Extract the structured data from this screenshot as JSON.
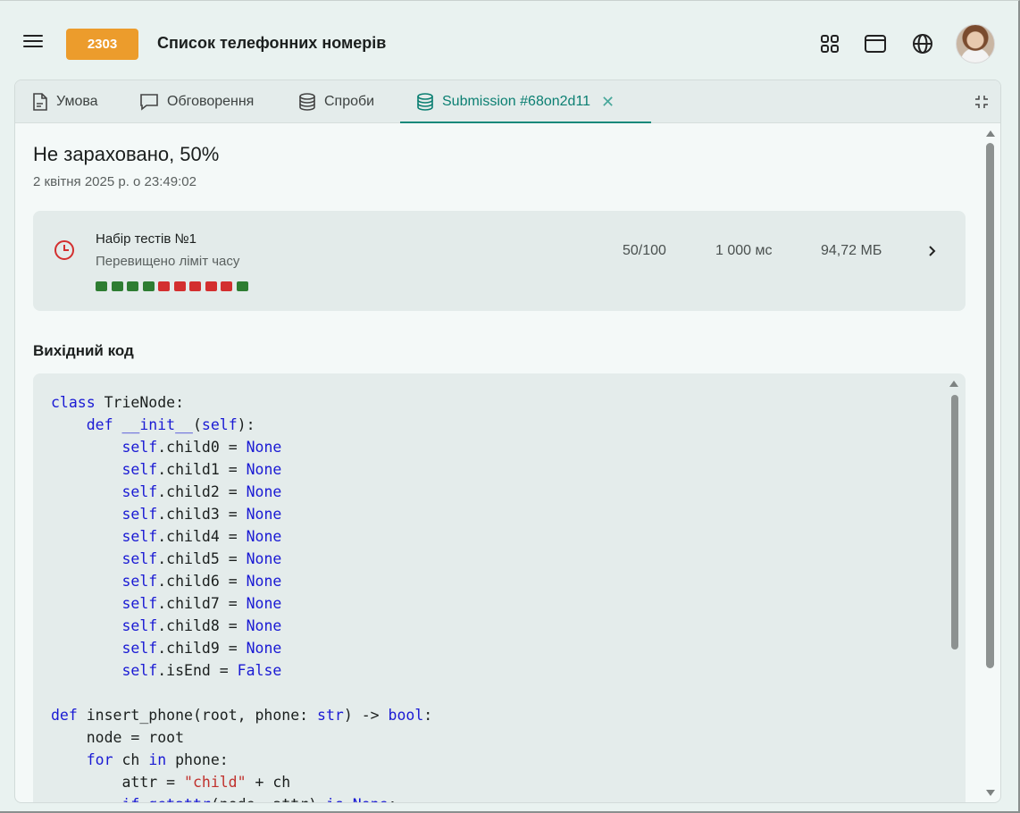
{
  "header": {
    "badge": "2303",
    "title": "Список телефонних номерів",
    "icons": [
      "menu-icon",
      "apps-grid-icon",
      "window-icon",
      "globe-icon"
    ]
  },
  "tabs": [
    {
      "label": "Умова",
      "icon": "document-icon"
    },
    {
      "label": "Обговорення",
      "icon": "chat-icon"
    },
    {
      "label": "Спроби",
      "icon": "database-icon"
    },
    {
      "label": "Submission #68on2d11",
      "icon": "database-icon",
      "active": true
    }
  ],
  "submission": {
    "verdict": "Не зараховано, 50%",
    "date": "2 квітня 2025 р. о 23:49:02"
  },
  "testset": {
    "name": "Набір тестів №1",
    "status": "Перевищено ліміт часу",
    "score": "50/100",
    "time": "1 000 мс",
    "memory": "94,72 МБ",
    "results": [
      "pass",
      "pass",
      "pass",
      "pass",
      "fail",
      "fail",
      "fail",
      "fail",
      "fail",
      "pass"
    ],
    "colors": {
      "pass": "#2e7d32",
      "fail": "#d32f2f"
    }
  },
  "source": {
    "label": "Вихідний код",
    "lines": [
      [
        [
          "kw",
          "class"
        ],
        [
          "t",
          " TrieNode:"
        ]
      ],
      [
        [
          "t",
          "    "
        ],
        [
          "kw",
          "def"
        ],
        [
          "t",
          " "
        ],
        [
          "kw",
          "__init__"
        ],
        [
          "t",
          "("
        ],
        [
          "kw",
          "self"
        ],
        [
          "t",
          "):"
        ]
      ],
      [
        [
          "t",
          "        "
        ],
        [
          "kw",
          "self"
        ],
        [
          "t",
          ".child0 = "
        ],
        [
          "kw",
          "None"
        ]
      ],
      [
        [
          "t",
          "        "
        ],
        [
          "kw",
          "self"
        ],
        [
          "t",
          ".child1 = "
        ],
        [
          "kw",
          "None"
        ]
      ],
      [
        [
          "t",
          "        "
        ],
        [
          "kw",
          "self"
        ],
        [
          "t",
          ".child2 = "
        ],
        [
          "kw",
          "None"
        ]
      ],
      [
        [
          "t",
          "        "
        ],
        [
          "kw",
          "self"
        ],
        [
          "t",
          ".child3 = "
        ],
        [
          "kw",
          "None"
        ]
      ],
      [
        [
          "t",
          "        "
        ],
        [
          "kw",
          "self"
        ],
        [
          "t",
          ".child4 = "
        ],
        [
          "kw",
          "None"
        ]
      ],
      [
        [
          "t",
          "        "
        ],
        [
          "kw",
          "self"
        ],
        [
          "t",
          ".child5 = "
        ],
        [
          "kw",
          "None"
        ]
      ],
      [
        [
          "t",
          "        "
        ],
        [
          "kw",
          "self"
        ],
        [
          "t",
          ".child6 = "
        ],
        [
          "kw",
          "None"
        ]
      ],
      [
        [
          "t",
          "        "
        ],
        [
          "kw",
          "self"
        ],
        [
          "t",
          ".child7 = "
        ],
        [
          "kw",
          "None"
        ]
      ],
      [
        [
          "t",
          "        "
        ],
        [
          "kw",
          "self"
        ],
        [
          "t",
          ".child8 = "
        ],
        [
          "kw",
          "None"
        ]
      ],
      [
        [
          "t",
          "        "
        ],
        [
          "kw",
          "self"
        ],
        [
          "t",
          ".child9 = "
        ],
        [
          "kw",
          "None"
        ]
      ],
      [
        [
          "t",
          "        "
        ],
        [
          "kw",
          "self"
        ],
        [
          "t",
          ".isEnd = "
        ],
        [
          "kw",
          "False"
        ]
      ],
      [
        [
          "t",
          ""
        ]
      ],
      [
        [
          "kw",
          "def"
        ],
        [
          "t",
          " insert_phone(root, phone: "
        ],
        [
          "kw",
          "str"
        ],
        [
          "t",
          ") -> "
        ],
        [
          "kw",
          "bool"
        ],
        [
          "t",
          ":"
        ]
      ],
      [
        [
          "t",
          "    node = root"
        ]
      ],
      [
        [
          "t",
          "    "
        ],
        [
          "kw",
          "for"
        ],
        [
          "t",
          " ch "
        ],
        [
          "kw",
          "in"
        ],
        [
          "t",
          " phone:"
        ]
      ],
      [
        [
          "t",
          "        attr = "
        ],
        [
          "str",
          "\"child\""
        ],
        [
          "t",
          " + ch"
        ]
      ],
      [
        [
          "t",
          "        "
        ],
        [
          "kw",
          "if"
        ],
        [
          "t",
          " "
        ],
        [
          "kw",
          "getattr"
        ],
        [
          "t",
          "(node, attr) "
        ],
        [
          "kw",
          "is"
        ],
        [
          "t",
          " "
        ],
        [
          "kw",
          "None"
        ],
        [
          "t",
          ":"
        ]
      ]
    ]
  }
}
